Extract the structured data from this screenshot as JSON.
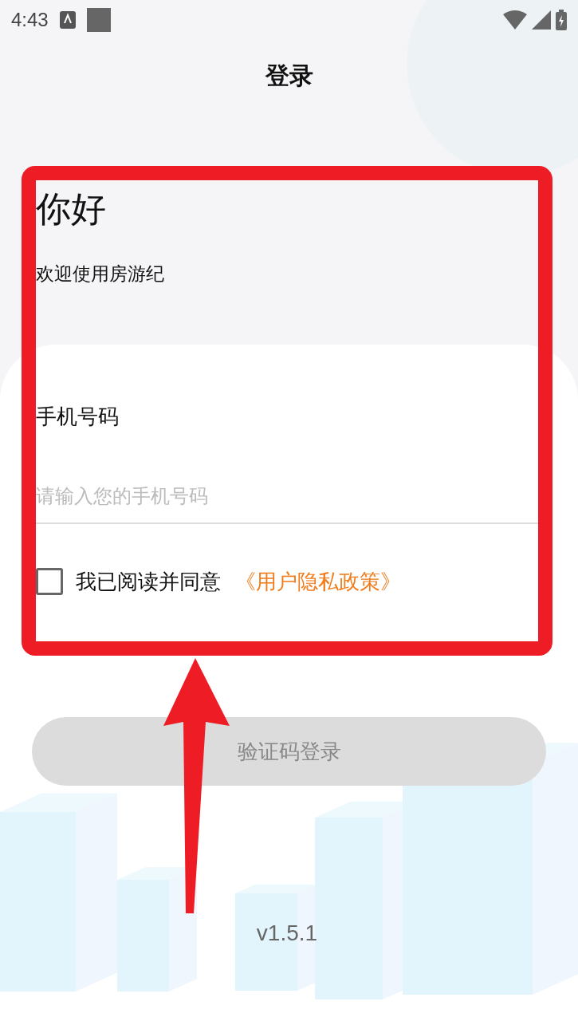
{
  "status_bar": {
    "time": "4:43"
  },
  "title": "登录",
  "greeting": "你好",
  "welcome": "欢迎使用房游纪",
  "phone": {
    "label": "手机号码",
    "placeholder": "请输入您的手机号码"
  },
  "agreement": {
    "checked": false,
    "text": "我已阅读并同意",
    "link": "《用户隐私政策》"
  },
  "login_button": {
    "label": "验证码登录",
    "disabled": true
  },
  "version": "v1.5.1"
}
